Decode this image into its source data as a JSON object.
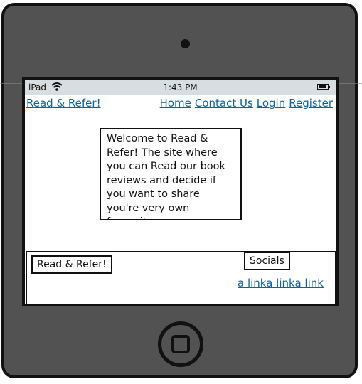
{
  "device": {
    "status_bar": {
      "carrier": "iPad",
      "time": "1:43 PM"
    }
  },
  "navbar": {
    "brand": "Read & Refer!",
    "links": [
      "Home",
      "Contact Us",
      "Login",
      "Register"
    ]
  },
  "welcome": {
    "text": "Welcome to Read & Refer! The site where you can Read our book reviews and decide if you want to share you're very own favourite"
  },
  "footer": {
    "brand": "Read & Refer!",
    "socials_label": "Socials",
    "links": "a linka linka link"
  },
  "colors": {
    "link": "#0b62a4",
    "device_body": "#525252",
    "status_bar": "#d7dee2"
  }
}
